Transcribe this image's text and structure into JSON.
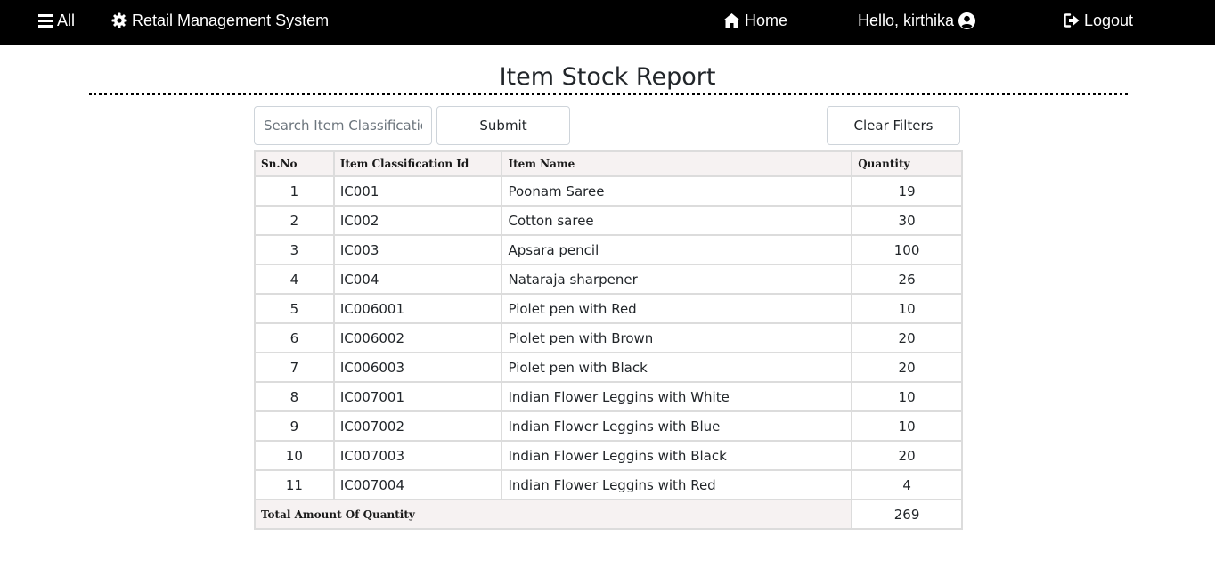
{
  "navbar": {
    "all_label": "All",
    "brand_label": "Retail Management System",
    "home_label": "Home",
    "greeting_label": "Hello, kirthika",
    "logout_label": "Logout",
    "icons": {
      "all": "hamburger-icon",
      "brand": "gear-icon",
      "home": "home-icon",
      "user": "user-circle-icon",
      "logout": "logout-icon"
    },
    "background": "#000000",
    "text_color": "#ffffff"
  },
  "page": {
    "title": "Item Stock Report"
  },
  "controls": {
    "search_placeholder": "Search Item Classification",
    "search_value": "",
    "submit_label": "Submit",
    "clear_label": "Clear Filters"
  },
  "table": {
    "headers": {
      "sn": "Sn.No",
      "id": "Item Classification Id",
      "name": "Item Name",
      "qty": "Quantity"
    },
    "rows": [
      {
        "sn": "1",
        "id": "IC001",
        "name": "Poonam Saree",
        "qty": "19"
      },
      {
        "sn": "2",
        "id": "IC002",
        "name": "Cotton saree",
        "qty": "30"
      },
      {
        "sn": "3",
        "id": "IC003",
        "name": "Apsara pencil",
        "qty": "100"
      },
      {
        "sn": "4",
        "id": "IC004",
        "name": "Nataraja sharpener",
        "qty": "26"
      },
      {
        "sn": "5",
        "id": "IC006001",
        "name": "Piolet pen with Red",
        "qty": "10"
      },
      {
        "sn": "6",
        "id": "IC006002",
        "name": "Piolet pen with Brown",
        "qty": "20"
      },
      {
        "sn": "7",
        "id": "IC006003",
        "name": "Piolet pen with Black",
        "qty": "20"
      },
      {
        "sn": "8",
        "id": "IC007001",
        "name": "Indian Flower Leggins with White",
        "qty": "10"
      },
      {
        "sn": "9",
        "id": "IC007002",
        "name": "Indian Flower Leggins with Blue",
        "qty": "10"
      },
      {
        "sn": "10",
        "id": "IC007003",
        "name": "Indian Flower Leggins with Black",
        "qty": "20"
      },
      {
        "sn": "11",
        "id": "IC007004",
        "name": "Indian Flower Leggins with Red",
        "qty": "4"
      }
    ],
    "total_label": "Total Amount Of Quantity",
    "total_value": "269",
    "header_background": "#f6f2f2",
    "border_color": "#dcdcdc"
  }
}
